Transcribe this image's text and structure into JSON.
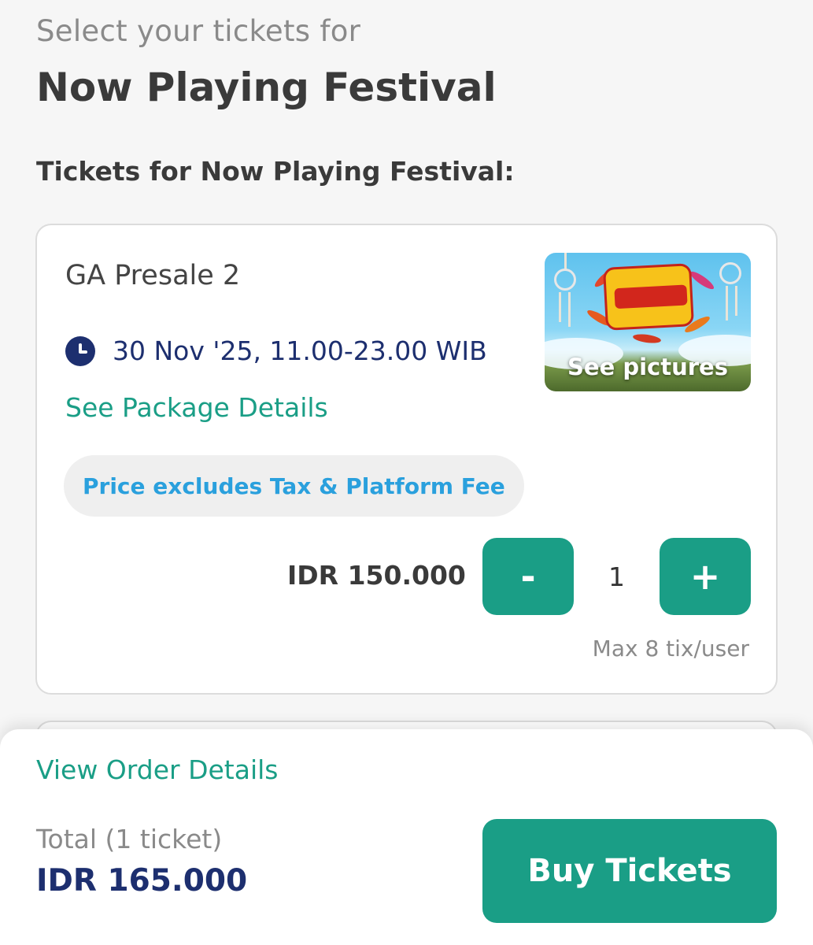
{
  "header": {
    "subtitle": "Select your tickets for",
    "title": "Now Playing Festival"
  },
  "tickets_section": {
    "heading": "Tickets for Now Playing Festival:"
  },
  "ticket": {
    "name": "GA Presale 2",
    "date": "30 Nov '25, 11.00-23.00 WIB",
    "package_link": "See Package Details",
    "price_note": "Price excludes Tax & Platform Fee",
    "thumbnail_label": "See pictures",
    "price": "IDR 150.000",
    "quantity": "1",
    "minus_label": "-",
    "plus_label": "+",
    "max_note": "Max 8 tix/user"
  },
  "footer": {
    "order_link": "View Order Details",
    "total_label": "Total (1 ticket)",
    "total_amount": "IDR 165.000",
    "buy_label": "Buy Tickets"
  },
  "colors": {
    "accent": "#1a9e86",
    "navy": "#1d2f6f",
    "note_blue": "#2aa0dd"
  },
  "icons": {
    "date": "clock-icon"
  }
}
